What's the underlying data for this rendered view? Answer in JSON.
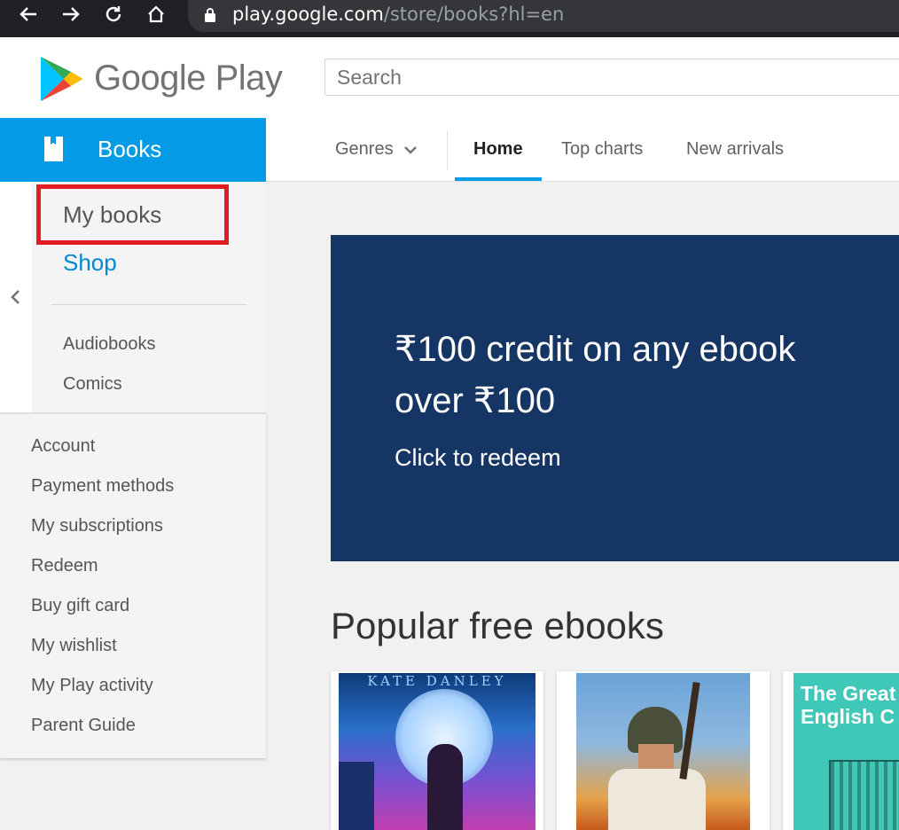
{
  "browser": {
    "url_host": "play.google.com",
    "url_path": "/store/books?hl=en"
  },
  "header": {
    "logo_text": "Google Play",
    "search_placeholder": "Search"
  },
  "books_tab": {
    "label": "Books"
  },
  "topnav": {
    "genres": "Genres",
    "home": "Home",
    "top_charts": "Top charts",
    "new_arrivals": "New arrivals",
    "active": "Home"
  },
  "sidebar": {
    "my_books": "My books",
    "shop": "Shop",
    "audiobooks": "Audiobooks",
    "comics": "Comics"
  },
  "account_menu": [
    "Account",
    "Payment methods",
    "My subscriptions",
    "Redeem",
    "Buy gift card",
    "My wishlist",
    "My Play activity",
    "Parent Guide"
  ],
  "banner": {
    "headline": "₹100 credit on any ebook over ₹100",
    "cta": "Click to redeem"
  },
  "section": {
    "title": "Popular free ebooks"
  },
  "books": [
    {
      "cover_text": "KATE DANLEY"
    },
    {
      "cover_text": ""
    },
    {
      "cover_text": "The Great English C"
    }
  ],
  "colors": {
    "accent": "#039be5",
    "banner_bg": "#153564",
    "highlight": "#e31b23"
  }
}
